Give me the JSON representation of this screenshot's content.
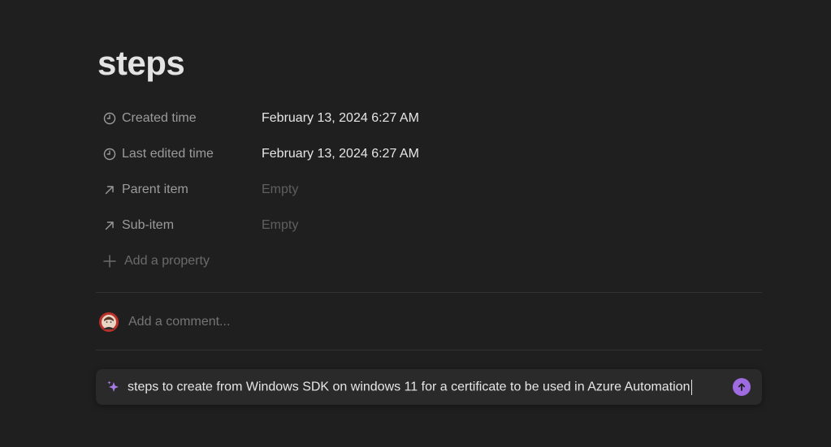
{
  "page": {
    "title": "steps"
  },
  "properties": [
    {
      "icon": "clock-icon",
      "label": "Created time",
      "value": "February 13, 2024 6:27 AM",
      "empty": false
    },
    {
      "icon": "clock-icon",
      "label": "Last edited time",
      "value": "February 13, 2024 6:27 AM",
      "empty": false
    },
    {
      "icon": "arrow-up-right-icon",
      "label": "Parent item",
      "value": "Empty",
      "empty": true
    },
    {
      "icon": "arrow-up-right-icon",
      "label": "Sub-item",
      "value": "Empty",
      "empty": true
    }
  ],
  "add_property": {
    "icon": "plus-icon",
    "label": "Add a property"
  },
  "comment": {
    "avatar_icon": "avatar",
    "placeholder": "Add a comment..."
  },
  "ai_prompt": {
    "icon": "sparkle-icon",
    "text": "steps to create from Windows SDK on windows 11 for a  certificate to be used in Azure Automation",
    "send_icon": "arrow-up-circle-icon",
    "accent_color": "#9f6be0"
  }
}
